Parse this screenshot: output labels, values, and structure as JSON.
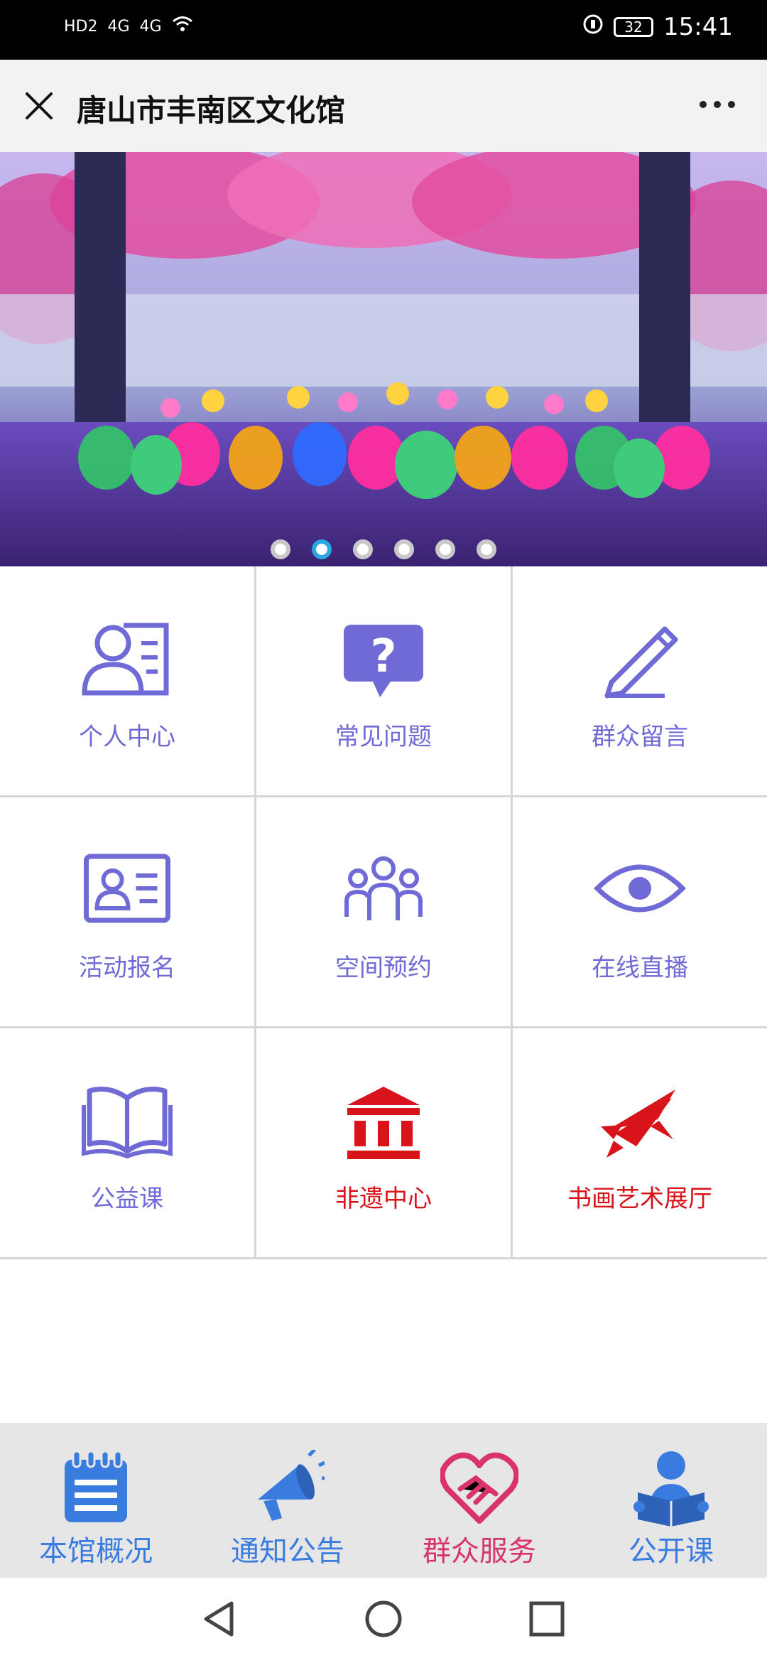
{
  "status_bar": {
    "time": "15:41",
    "battery": "32",
    "network": [
      "HD2",
      "4G",
      "4G"
    ]
  },
  "header": {
    "title": "唐山市丰南区文化馆"
  },
  "banner": {
    "slide_count": 6,
    "active_index": 1
  },
  "grid": [
    {
      "label": "个人中心",
      "icon": "person-card-icon",
      "color": "#6f6ad6"
    },
    {
      "label": "常见问题",
      "icon": "question-bubble-icon",
      "color": "#6f6ad6"
    },
    {
      "label": "群众留言",
      "icon": "pencil-icon",
      "color": "#6f6ad6"
    },
    {
      "label": "活动报名",
      "icon": "id-card-icon",
      "color": "#6f6ad6"
    },
    {
      "label": "空间预约",
      "icon": "people-group-icon",
      "color": "#6f6ad6"
    },
    {
      "label": "在线直播",
      "icon": "eye-icon",
      "color": "#6f6ad6"
    },
    {
      "label": "公益课",
      "icon": "open-book-icon",
      "color": "#6f6ad6"
    },
    {
      "label": "非遗中心",
      "icon": "museum-icon",
      "color": "#d8141a"
    },
    {
      "label": "书画艺术展厅",
      "icon": "brush-rocket-icon",
      "color": "#d8141a"
    }
  ],
  "bottom_nav": [
    {
      "label": "本馆概况",
      "icon": "notepad-icon",
      "color": "#3a7be0"
    },
    {
      "label": "通知公告",
      "icon": "megaphone-icon",
      "color": "#3a7be0"
    },
    {
      "label": "群众服务",
      "icon": "handshake-heart-icon",
      "color": "#d8336b"
    },
    {
      "label": "公开课",
      "icon": "reader-icon",
      "color": "#3a7be0"
    }
  ]
}
